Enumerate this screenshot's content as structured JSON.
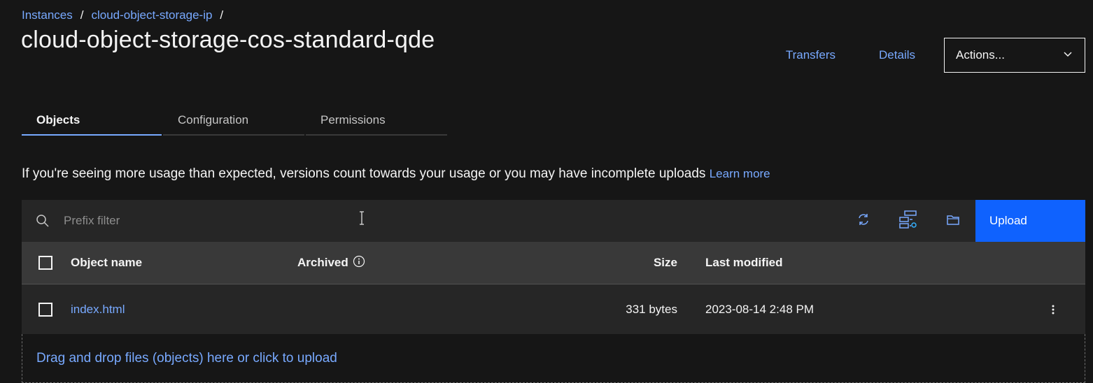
{
  "breadcrumb": {
    "items": [
      "Instances",
      "cloud-object-storage-ip"
    ],
    "separator": "/"
  },
  "page": {
    "title": "cloud-object-storage-cos-standard-qde"
  },
  "header": {
    "transfers_label": "Transfers",
    "details_label": "Details",
    "actions_label": "Actions..."
  },
  "tabs": [
    {
      "label": "Objects",
      "active": true
    },
    {
      "label": "Configuration",
      "active": false
    },
    {
      "label": "Permissions",
      "active": false
    }
  ],
  "notice": {
    "text": "If you're seeing more usage than expected, versions count towards your usage or you may have incomplete uploads",
    "link_label": "Learn more"
  },
  "toolbar": {
    "search_placeholder": "Prefix filter",
    "upload_label": "Upload",
    "icons": [
      "refresh-icon",
      "object-tree-settings-icon",
      "folder-icon"
    ]
  },
  "table": {
    "columns": {
      "name": "Object name",
      "archived": "Archived",
      "size": "Size",
      "modified": "Last modified"
    },
    "rows": [
      {
        "name": "index.html",
        "archived": "",
        "size": "331 bytes",
        "modified": "2023-08-14 2:48 PM"
      }
    ]
  },
  "dropzone": {
    "text": "Drag and drop files (objects) here or click to upload"
  },
  "colors": {
    "background": "#161616",
    "link": "#78a9ff",
    "primary": "#0f62fe",
    "surface": "#262626",
    "header": "#393939"
  }
}
